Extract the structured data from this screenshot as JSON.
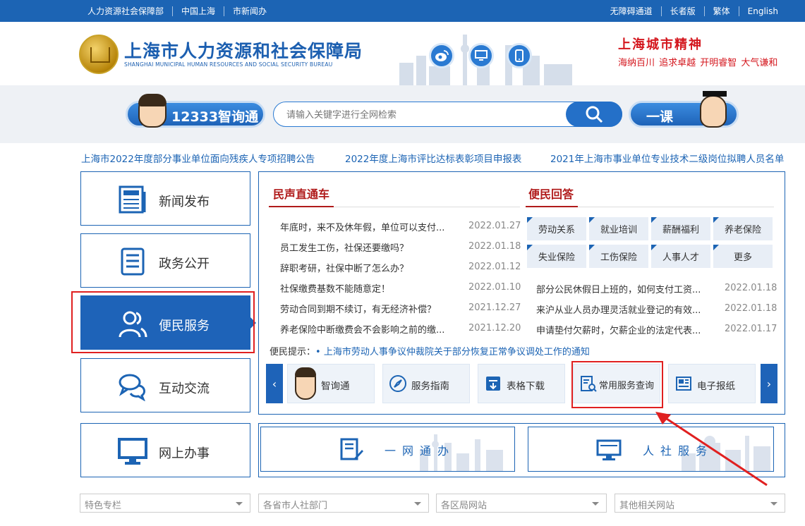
{
  "topbar": {
    "left_links": [
      "人力资源社会保障部",
      "中国上海",
      "市新闻办"
    ],
    "right_links": [
      "无障碍通道",
      "长者版",
      "繁体",
      "English"
    ]
  },
  "header": {
    "title": "上海市人力资源和社会保障局",
    "subtitle": "SHANGHAI MUNICIPAL HUMAN RESOURCES AND SOCIAL SECURITY BUREAU",
    "spirit_title": "上海城市精神",
    "spirit_words": "海纳百川 追求卓越 开明睿智 大气谦和"
  },
  "search": {
    "zhixuntong_label": "12333智询通",
    "placeholder": "请输入关键字进行全网检索",
    "yike_label": "一课"
  },
  "ticker": [
    "上海市2022年度部分事业单位面向残疾人专项招聘公告",
    "2022年度上海市评比达标表彰项目申报表",
    "2021年上海市事业单位专业技术二级岗位拟聘人员名单"
  ],
  "sidenav": [
    "新闻发布",
    "政务公开",
    "便民服务",
    "互动交流",
    "网上办事"
  ],
  "panel": {
    "tab_left": "民声直通车",
    "tab_right": "便民回答",
    "left_news": [
      {
        "title": "年底时，来不及休年假，单位可以支付...",
        "date": "2022.01.27"
      },
      {
        "title": "员工发生工伤，社保还要缴吗？",
        "date": "2022.01.18"
      },
      {
        "title": "辞职考研，社保中断了怎么办？",
        "date": "2022.01.12"
      },
      {
        "title": "社保缴费基数不能随意定！",
        "date": "2022.01.10"
      },
      {
        "title": "劳动合同到期不续订，有无经济补偿？",
        "date": "2021.12.27"
      },
      {
        "title": "养老保险中断缴费会不会影响之前的缴...",
        "date": "2021.12.20"
      }
    ],
    "categories": [
      "劳动关系",
      "就业培训",
      "薪酬福利",
      "养老保险",
      "失业保险",
      "工伤保险",
      "人事人才",
      "更多"
    ],
    "right_news": [
      {
        "title": "部分公民休假日上班的，如何支付工资...",
        "date": "2022.01.18"
      },
      {
        "title": "来沪从业人员办理灵活就业登记的有效...",
        "date": "2022.01.18"
      },
      {
        "title": "申请垫付欠薪时，欠薪企业的法定代表...",
        "date": "2022.01.17"
      }
    ],
    "notice_label": "便民提示：",
    "notice_text": "• 上海市劳动人事争议仲裁院关于部分恢复正常争议调处工作的通知",
    "services": [
      "智询通",
      "服务指南",
      "表格下载",
      "常用服务查询",
      "电子报纸"
    ]
  },
  "big_buttons": [
    "一网通办",
    "人社服务"
  ],
  "dropdowns": [
    "特色专栏",
    "各省市人社部门",
    "各区局网站",
    "其他相关网站"
  ],
  "colors": {
    "brand_blue": "#1c64b4",
    "accent_red": "#d4161d",
    "highlight_red": "#e02020"
  }
}
